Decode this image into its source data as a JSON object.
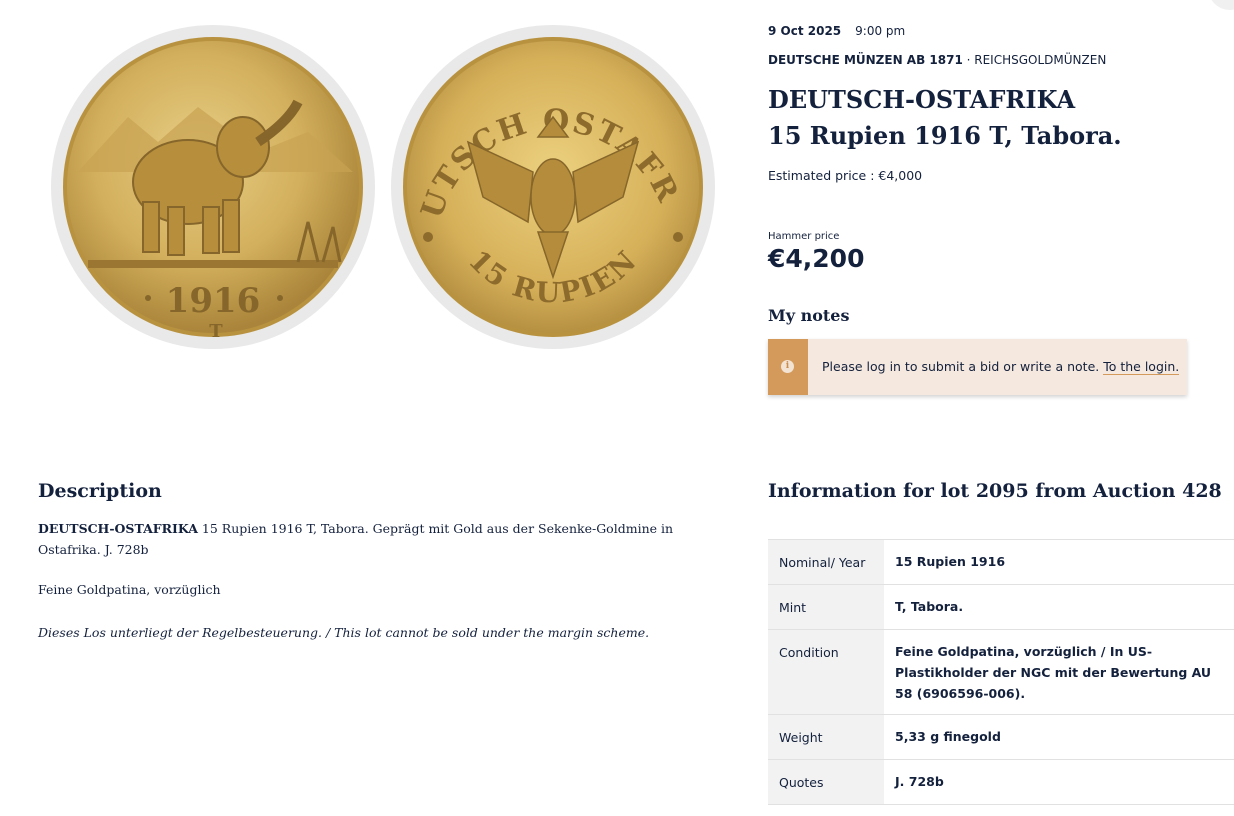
{
  "lot": {
    "date": "9 Oct 2025",
    "time": "9:00 pm",
    "category_bold": "DEUTSCHE MÜNZEN AB 1871",
    "category_rest": " · REICHSGOLDMÜNZEN",
    "title_line1": "DEUTSCH-OSTAFRIKA",
    "title_line2": "15 Rupien 1916 T, Tabora.",
    "estimate": "Estimated price : €4,000",
    "hammer_label": "Hammer price",
    "hammer_price": "€4,200"
  },
  "coin": {
    "obverse_year": "1916",
    "mint_mark": "T",
    "reverse_legend": "DEUTSCH OSTAFRIKA",
    "reverse_value": "15 RUPIEN"
  },
  "notes": {
    "title": "My notes",
    "message": "Please log in to submit a bid or write a note. ",
    "link": "To the login."
  },
  "description": {
    "title": "Description",
    "lead_bold": "DEUTSCH-OSTAFRIKA",
    "lead_text": " 15 Rupien 1916 T, Tabora. Geprägt mit Gold aus der Sekenke-Goldmine in Ostafrika. J. 728b",
    "condition": "Feine Goldpatina, vorzüglich",
    "tax_note": "Dieses Los unterliegt der Regelbesteuerung. / This lot cannot be sold under the margin scheme."
  },
  "info": {
    "title": "Information for lot 2095 from Auction 428",
    "rows": [
      {
        "key": "Nominal/ Year",
        "value": "15 Rupien 1916"
      },
      {
        "key": "Mint",
        "value": "T, Tabora."
      },
      {
        "key": "Condition",
        "value": "Feine Goldpatina, vorzüglich / In US-Plastikholder der NGC mit der Bewertung AU 58 (6906596-006)."
      },
      {
        "key": "Weight",
        "value": "5,33 g finegold"
      },
      {
        "key": "Quotes",
        "value": "J. 728b"
      }
    ]
  },
  "colors": {
    "text": "#14213d",
    "notice_bg": "#f5e8de",
    "notice_accent": "#d39a5c",
    "gold": "#c9a24a"
  }
}
